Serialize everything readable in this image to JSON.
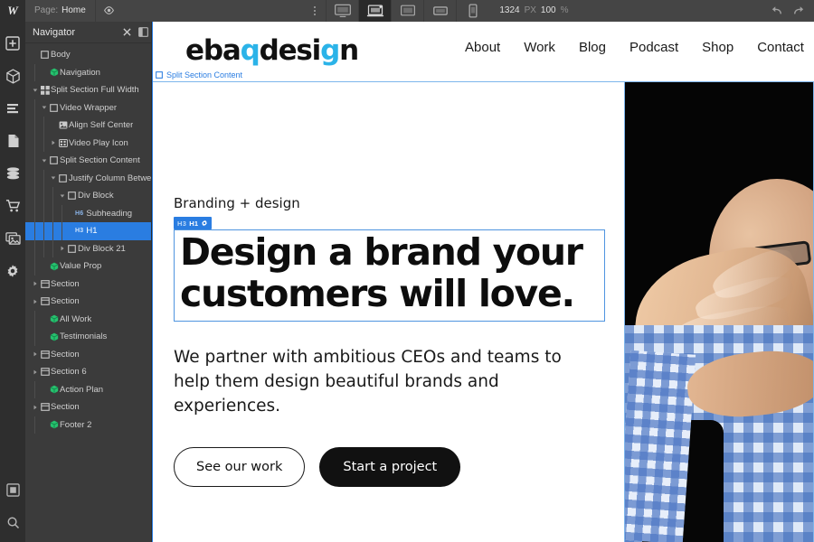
{
  "topbar": {
    "brand": "W",
    "page_label": "Page:",
    "page_value": "Home",
    "preview_icon": "eye-icon",
    "kebab_icon": "more-options-icon",
    "devices": [
      {
        "name": "desktop",
        "icon": "desktop-icon",
        "active": false
      },
      {
        "name": "laptop",
        "icon": "laptop-icon",
        "active": true
      },
      {
        "name": "tablet-landscape",
        "icon": "tablet-landscape-icon",
        "active": false
      },
      {
        "name": "tablet-portrait",
        "icon": "tablet-portrait-icon",
        "active": false
      },
      {
        "name": "mobile",
        "icon": "mobile-icon",
        "active": false
      }
    ],
    "viewport_width": "1324",
    "viewport_unit": "PX",
    "zoom_value": "100",
    "zoom_unit": "%",
    "undo_icon": "undo-arrow-icon",
    "redo_icon": "redo-arrow-icon"
  },
  "rail": {
    "items": [
      {
        "name": "add-elements",
        "icon": "plus-square-icon"
      },
      {
        "name": "components",
        "icon": "cube-icon"
      },
      {
        "name": "style-manager",
        "icon": "paintbrush-lines-icon"
      },
      {
        "name": "pages",
        "icon": "page-document-icon"
      },
      {
        "name": "cms-collections",
        "icon": "database-icon"
      },
      {
        "name": "ecommerce",
        "icon": "shopping-cart-icon"
      },
      {
        "name": "assets",
        "icon": "images-icon"
      },
      {
        "name": "settings",
        "icon": "gear-icon"
      }
    ],
    "bottom_items": [
      {
        "name": "video-tutorials",
        "icon": "square-frame-icon"
      },
      {
        "name": "search",
        "icon": "magnifier-icon"
      }
    ]
  },
  "navigator": {
    "title": "Navigator",
    "close_icon": "close-x-icon",
    "collapse_icon": "panel-collapse-icon",
    "tree": [
      {
        "label": "Body",
        "depth": 0,
        "icon": "body-square-icon",
        "arrow": "none",
        "tag": "",
        "selected": false
      },
      {
        "label": "Navigation",
        "depth": 1,
        "icon": "component-icon",
        "arrow": "none",
        "tag": "",
        "selected": false
      },
      {
        "label": "Split Section Full Width",
        "depth": 0,
        "icon": "grid-blocks-icon",
        "arrow": "expanded",
        "tag": "",
        "selected": false
      },
      {
        "label": "Video Wrapper",
        "depth": 1,
        "icon": "div-square-icon",
        "arrow": "expanded",
        "tag": "",
        "selected": false
      },
      {
        "label": "Align Self Center",
        "depth": 2,
        "icon": "image-icon",
        "arrow": "none",
        "tag": "",
        "selected": false
      },
      {
        "label": "Video Play Icon",
        "depth": 2,
        "icon": "grid-small-icon",
        "arrow": "collapsed",
        "tag": "",
        "selected": false
      },
      {
        "label": "Split Section Content",
        "depth": 1,
        "icon": "div-square-icon",
        "arrow": "expanded",
        "tag": "",
        "selected": false
      },
      {
        "label": "Justify Column Betwe",
        "depth": 2,
        "icon": "div-square-icon",
        "arrow": "expanded",
        "tag": "",
        "selected": false
      },
      {
        "label": "Div Block",
        "depth": 3,
        "icon": "div-square-icon",
        "arrow": "expanded",
        "tag": "",
        "selected": false
      },
      {
        "label": "Subheading",
        "depth": 4,
        "icon": "none",
        "arrow": "none",
        "tag": "H6",
        "selected": false
      },
      {
        "label": "H1",
        "depth": 4,
        "icon": "none",
        "arrow": "none",
        "tag": "H3",
        "selected": true
      },
      {
        "label": "Div Block 21",
        "depth": 3,
        "icon": "div-square-icon",
        "arrow": "collapsed",
        "tag": "",
        "selected": false
      },
      {
        "label": "Value Prop",
        "depth": 1,
        "icon": "component-icon",
        "arrow": "none",
        "tag": "",
        "selected": false
      },
      {
        "label": "Section",
        "depth": 0,
        "icon": "section-icon",
        "arrow": "collapsed",
        "tag": "",
        "selected": false
      },
      {
        "label": "Section",
        "depth": 0,
        "icon": "section-icon",
        "arrow": "collapsed",
        "tag": "",
        "selected": false
      },
      {
        "label": "All Work",
        "depth": 1,
        "icon": "component-icon",
        "arrow": "none",
        "tag": "",
        "selected": false
      },
      {
        "label": "Testimonials",
        "depth": 1,
        "icon": "component-icon",
        "arrow": "none",
        "tag": "",
        "selected": false
      },
      {
        "label": "Section",
        "depth": 0,
        "icon": "section-icon",
        "arrow": "collapsed",
        "tag": "",
        "selected": false
      },
      {
        "label": "Section 6",
        "depth": 0,
        "icon": "section-icon",
        "arrow": "collapsed",
        "tag": "",
        "selected": false
      },
      {
        "label": "Action Plan",
        "depth": 1,
        "icon": "component-icon",
        "arrow": "none",
        "tag": "",
        "selected": false
      },
      {
        "label": "Section",
        "depth": 0,
        "icon": "section-icon",
        "arrow": "collapsed",
        "tag": "",
        "selected": false
      },
      {
        "label": "Footer 2",
        "depth": 1,
        "icon": "component-icon",
        "arrow": "none",
        "tag": "",
        "selected": false
      }
    ]
  },
  "canvas": {
    "hover_badge": {
      "label": "Split Section Content",
      "icon": "div-square-icon"
    },
    "selection_badge": {
      "tag_secondary": "H3",
      "tag_primary": "H1",
      "settings_icon": "gear-icon"
    },
    "site": {
      "logo_text": "ebaqdesign",
      "nav_items": [
        "About",
        "Work",
        "Blog",
        "Podcast",
        "Shop",
        "Contact"
      ],
      "subheading": "Branding + design",
      "heading": "Design a brand your customers will love.",
      "body": "We partner with ambitious CEOs and teams to help them design beautiful brands and experiences.",
      "button_secondary": "See our work",
      "button_primary": "Start a project",
      "photo_alt": "portrait-photo"
    }
  },
  "colors": {
    "accent_blue": "#2a7de1",
    "selection_outline": "#4f94e0",
    "panel_bg": "#3b3b3b",
    "rail_bg": "#2e2e2e",
    "logo_dot": "#2bb3e8",
    "black": "#111111"
  }
}
